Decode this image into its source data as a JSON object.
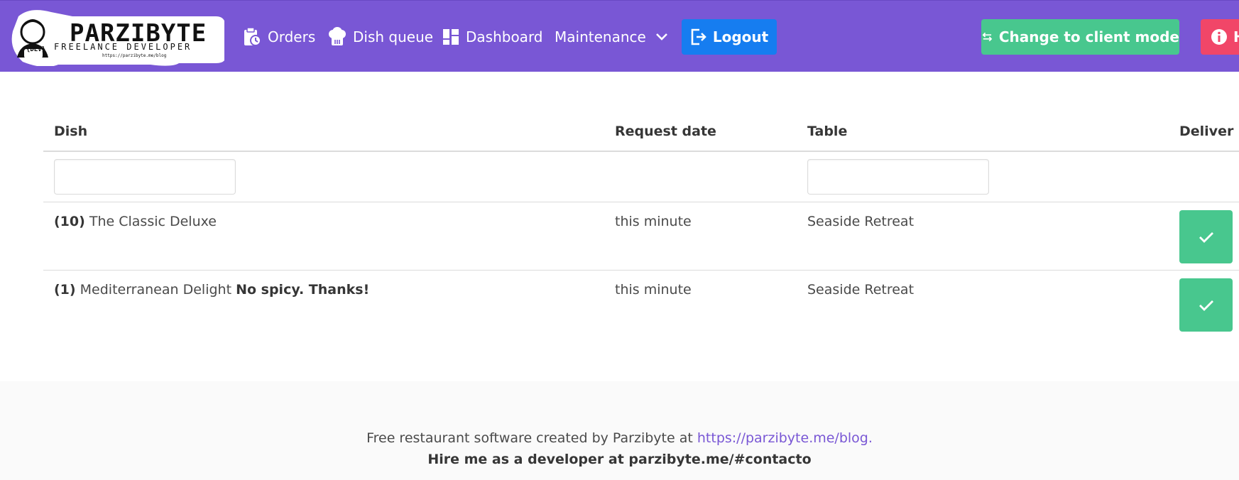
{
  "navbar": {
    "logo": {
      "brand": "PARZIBYTE",
      "tagline": "FREELANCE DEVELOPER",
      "url": "https://parzibyte.me/blog",
      "badge": "{DEV}"
    },
    "items": [
      {
        "label": "Orders",
        "icon": "clipboard-clock-icon"
      },
      {
        "label": "Dish queue",
        "icon": "chef-hat-icon"
      },
      {
        "label": "Dashboard",
        "icon": "dashboard-icon"
      },
      {
        "label": "Maintenance",
        "icon": "chevron-down-icon"
      }
    ],
    "logout_label": "Logout",
    "client_mode_label": "Change to client mode",
    "help_label": "H"
  },
  "table": {
    "columns": [
      "Dish",
      "Request date",
      "Table",
      "Deliver"
    ],
    "filters": {
      "dish": "",
      "table": ""
    },
    "rows": [
      {
        "qty": "(10)",
        "dish": "The Classic Deluxe",
        "note": "",
        "date": "this minute",
        "table": "Seaside Retreat"
      },
      {
        "qty": "(1)",
        "dish": "Mediterranean Delight",
        "note": "No spicy. Thanks!",
        "date": "this minute",
        "table": "Seaside Retreat"
      }
    ]
  },
  "footer": {
    "text": "Free restaurant software created by Parzibyte at",
    "link": "https://parzibyte.me/blog.",
    "hire": "Hire me as a developer at parzibyte.me/#contacto"
  },
  "colors": {
    "navbar": "#7957d5",
    "success": "#48c78e",
    "info": "#167df0",
    "danger": "#f14668"
  }
}
